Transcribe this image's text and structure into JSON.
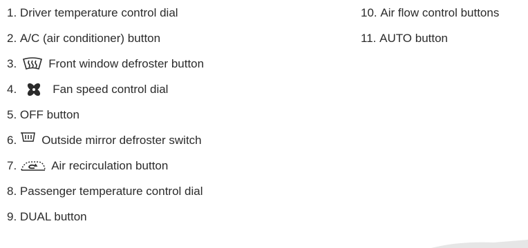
{
  "items_left": [
    {
      "num": "1.",
      "label": "Driver temperature control dial"
    },
    {
      "num": "2.",
      "label": "A/C (air conditioner) button"
    },
    {
      "num": "3.",
      "label": "Front window defroster button",
      "icon": "front-defroster-icon"
    },
    {
      "num": "4.",
      "label": "Fan speed control dial",
      "icon": "fan-icon"
    },
    {
      "num": "5.",
      "label": "OFF button"
    },
    {
      "num": "6.",
      "label": "Outside mirror defroster switch",
      "icon": "mirror-defroster-icon"
    },
    {
      "num": "7.",
      "label": "Air recirculation button",
      "icon": "air-recirculation-icon"
    },
    {
      "num": "8.",
      "label": "Passenger temperature control dial"
    },
    {
      "num": "9.",
      "label": "DUAL button"
    }
  ],
  "items_right": [
    {
      "num": "10.",
      "label": "Air flow control buttons"
    },
    {
      "num": "11.",
      "label": "AUTO button"
    }
  ],
  "colors": {
    "text": "#2b2b2b",
    "background": "#ffffff",
    "corner_mark": "#e6e6e6"
  }
}
